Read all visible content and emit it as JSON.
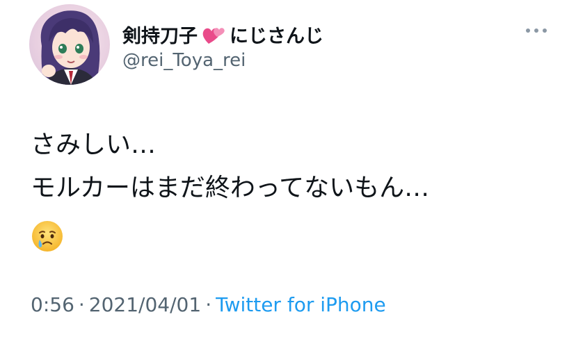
{
  "author": {
    "display_name": "剣持刀子",
    "display_name_suffix": "にじさんじ",
    "handle": "@rei_Toya_rei",
    "name_emoji": "two-hearts-icon"
  },
  "tweet": {
    "lines": [
      "さみしい…",
      "モルカーはまだ終わってないもん…"
    ],
    "emoji": "crying-face-icon"
  },
  "meta": {
    "time": "0:56",
    "separator": "·",
    "date": "2021/04/01",
    "source": "Twitter for iPhone"
  },
  "colors": {
    "text": "#0f1419",
    "secondary": "#536471",
    "link": "#1d9bf0",
    "more": "#8b98a5"
  }
}
